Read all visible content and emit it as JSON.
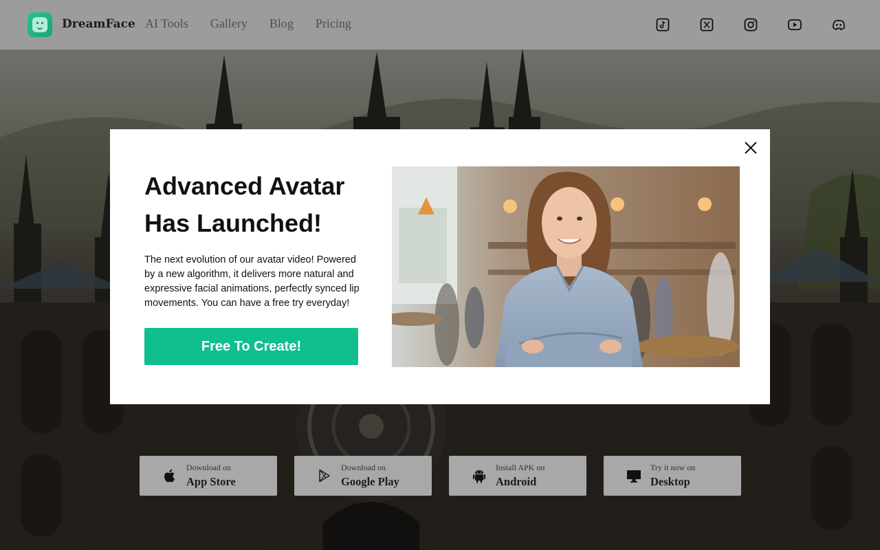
{
  "nav": {
    "brand": "DreamFace",
    "links": [
      "AI Tools",
      "Gallery",
      "Blog",
      "Pricing"
    ],
    "social_icons": [
      "tiktok-icon",
      "x-icon",
      "instagram-icon",
      "youtube-icon",
      "discord-icon"
    ]
  },
  "modal": {
    "title": "Advanced Avatar Has Launched!",
    "description": "The next evolution of our avatar video! Powered by a new algorithm, it delivers more natural and expressive facial animations, perfectly synced lip movements. You can have a free try everyday!",
    "cta_label": "Free To Create!",
    "close_icon": "close-icon"
  },
  "downloads": [
    {
      "small": "Download on",
      "big": "App Store",
      "icon": "apple-icon"
    },
    {
      "small": "Download on",
      "big": "Google Play",
      "icon": "google-play-icon"
    },
    {
      "small": "Install APK on",
      "big": "Android",
      "icon": "android-icon"
    },
    {
      "small": "Try it now on",
      "big": "Desktop",
      "icon": "desktop-icon"
    }
  ],
  "colors": {
    "accent": "#10bf8e",
    "nav_bg": "#9c9c9c",
    "modal_bg": "#ffffff",
    "download_bg": "#a8a8a8"
  }
}
